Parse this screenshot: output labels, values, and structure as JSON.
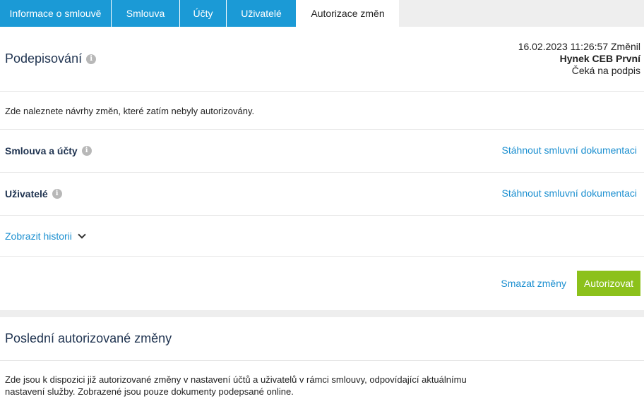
{
  "tabs": [
    {
      "label": "Informace o smlouvě",
      "active": false
    },
    {
      "label": "Smlouva",
      "active": false
    },
    {
      "label": "Účty",
      "active": false
    },
    {
      "label": "Uživatelé",
      "active": false
    },
    {
      "label": "Autorizace změn",
      "active": true
    }
  ],
  "signing": {
    "title": "Podepisování",
    "changed_at": "16.02.2023 11:26:57 Změnil",
    "changed_by": "Hynek CEB První",
    "status": "Čeká na podpis",
    "info_icon": "i"
  },
  "intro_text": "Zde naleznete návrhy změn, které zatím nebyly autorizovány.",
  "rows": [
    {
      "label": "Smlouva a účty",
      "link": "Stáhnout smluvní dokumentaci"
    },
    {
      "label": "Uživatelé",
      "link": "Stáhnout smluvní dokumentaci"
    }
  ],
  "history_link": "Zobrazit historii",
  "actions": {
    "delete_label": "Smazat změny",
    "authorize_label": "Autorizovat"
  },
  "last_changes": {
    "title": "Poslední autorizované změny",
    "text": "Zde jsou k dispozici již autorizované změny v nastavení účtů a uživatelů v rámci smlouvy, odpovídající aktuálnímu nastavení služby. Zobrazené jsou pouze dokumenty podepsané online."
  },
  "colors": {
    "tab_blue": "#1b9ad6",
    "link_blue": "#1b8fd0",
    "button_green": "#8cc11b",
    "heading_navy": "#1f3350"
  }
}
